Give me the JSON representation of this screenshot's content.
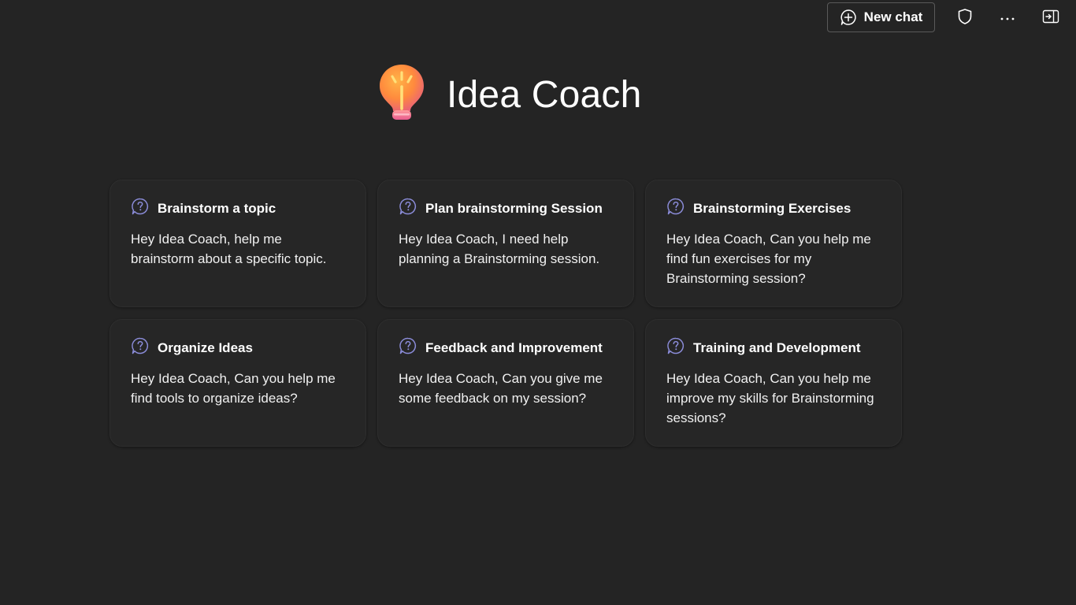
{
  "header": {
    "new_chat_label": "New chat"
  },
  "icons": {
    "new_chat": "plus-chat-icon",
    "shield": "shield-icon",
    "more": "more-icon",
    "panel": "open-panel-icon",
    "logo": "lightbulb-icon",
    "prompt": "chat-question-icon"
  },
  "colors": {
    "background": "#242424",
    "card": "#262626",
    "prompt_icon": "#8b8cd9"
  },
  "hero": {
    "title": "Idea Coach"
  },
  "cards": [
    {
      "title": "Brainstorm a topic",
      "text": "Hey Idea Coach, help me brainstorm about a specific topic."
    },
    {
      "title": "Plan brainstorming Session",
      "text": "Hey Idea Coach, I need help planning a Brainstorming session."
    },
    {
      "title": "Brainstorming Exercises",
      "text": "Hey Idea Coach, Can you help me find fun exercises for my Brainstorming session?"
    },
    {
      "title": "Organize Ideas",
      "text": "Hey Idea Coach, Can you help me find tools to organize ideas?"
    },
    {
      "title": "Feedback and Improvement",
      "text": "Hey Idea Coach, Can you give me some feedback on my session?"
    },
    {
      "title": "Training and Development",
      "text": "Hey Idea Coach, Can you help me improve my skills for Brainstorming sessions?"
    }
  ]
}
